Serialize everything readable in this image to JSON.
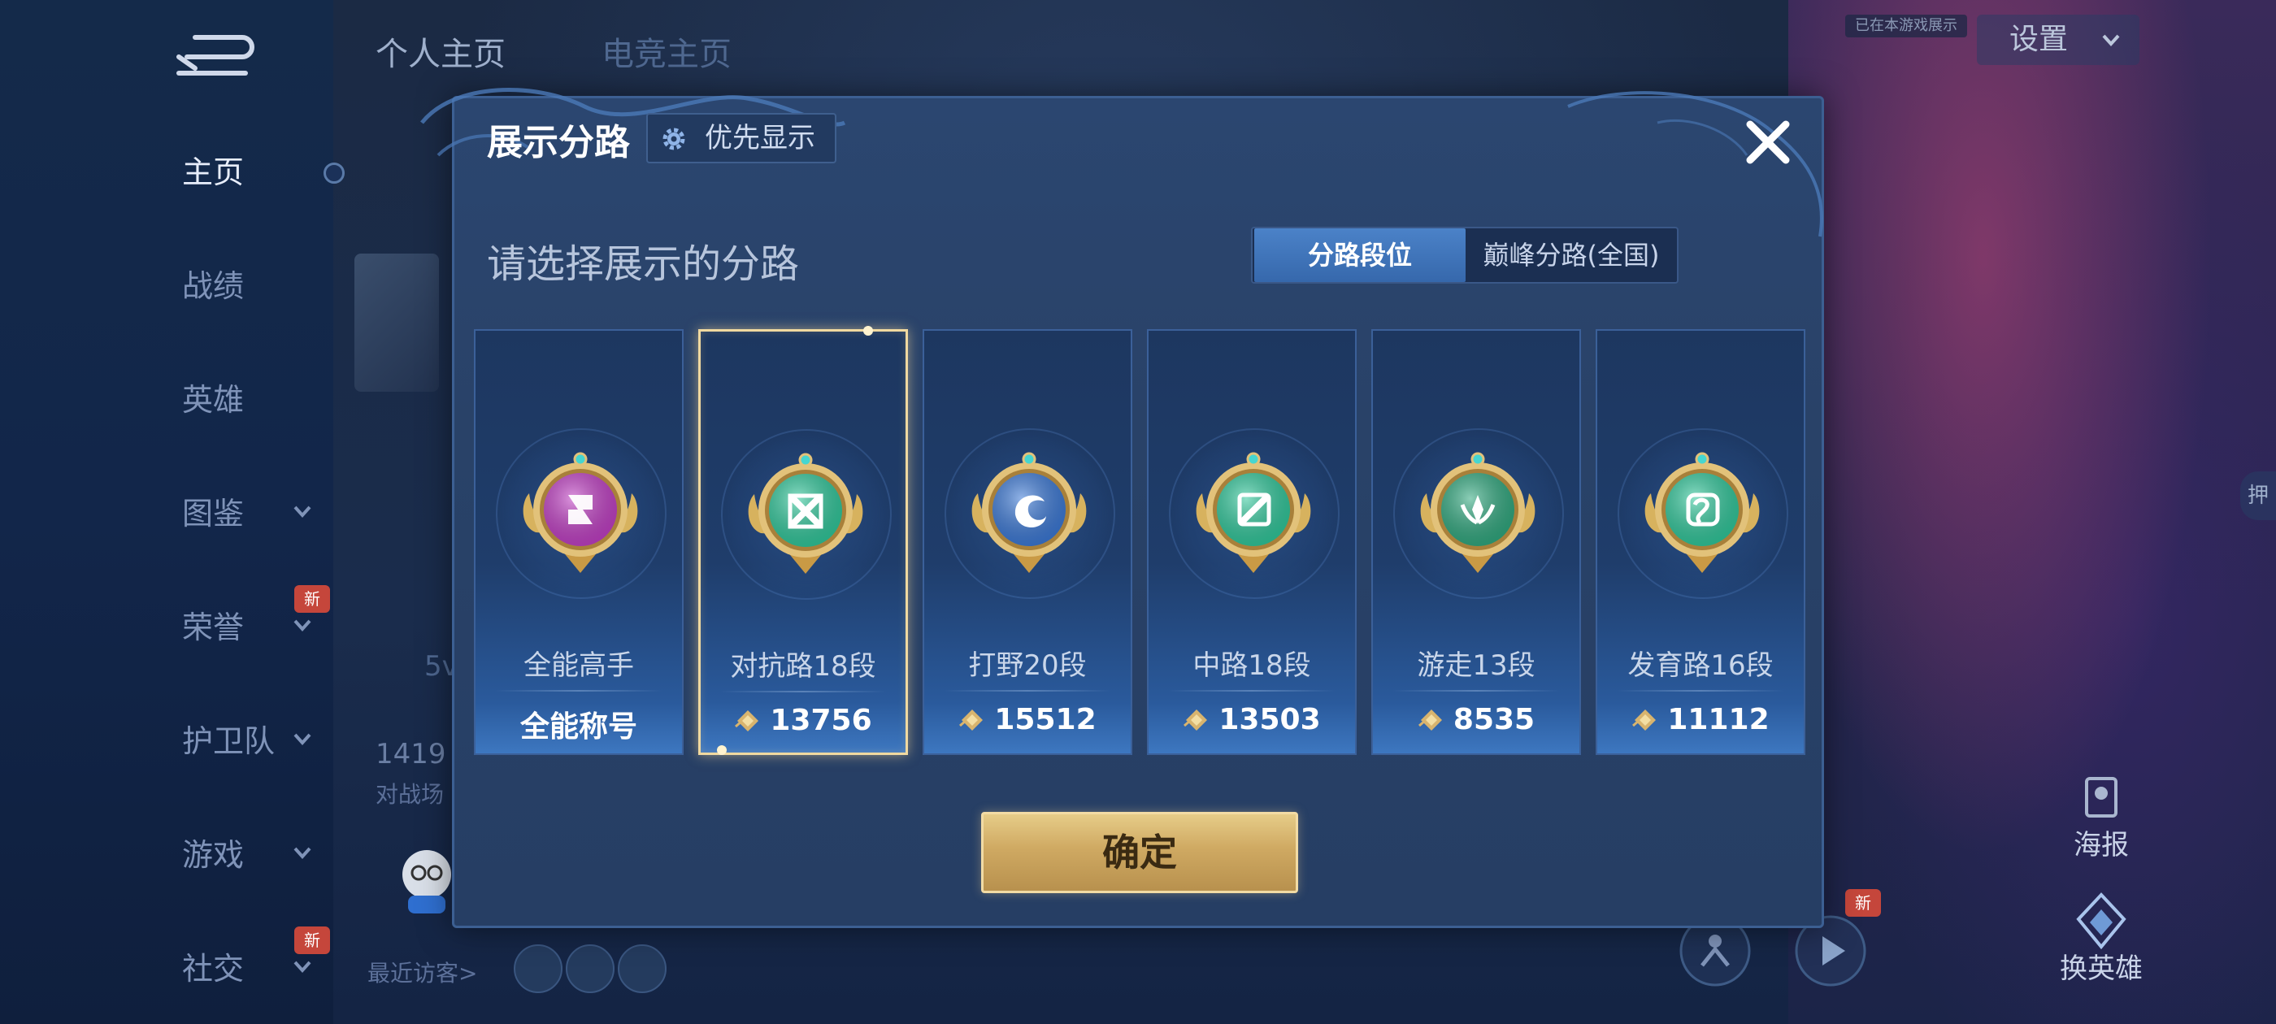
{
  "nav": {
    "items": [
      {
        "label": "主页",
        "active": true,
        "chevron": false,
        "new": false
      },
      {
        "label": "战绩",
        "active": false,
        "chevron": false,
        "new": false
      },
      {
        "label": "英雄",
        "active": false,
        "chevron": false,
        "new": false
      },
      {
        "label": "图鉴",
        "active": false,
        "chevron": true,
        "new": false
      },
      {
        "label": "荣誉",
        "active": false,
        "chevron": true,
        "new": true
      },
      {
        "label": "护卫队",
        "active": false,
        "chevron": true,
        "new": false
      },
      {
        "label": "游戏",
        "active": false,
        "chevron": true,
        "new": false
      },
      {
        "label": "社交",
        "active": false,
        "chevron": true,
        "new": true
      }
    ],
    "new_badge": "新"
  },
  "header": {
    "tabs": [
      "个人主页",
      "电竞主页"
    ],
    "settings_label": "设置",
    "chip_text": "已在本游戏展示"
  },
  "background": {
    "stat_number": "1419",
    "stat_label": "对战场",
    "side_text": "5v",
    "recent_visitors": "最近访客>",
    "poster_label": "海报",
    "change_hero_label": "换英雄",
    "new_badge": "新",
    "edge_badge": "押"
  },
  "dialog": {
    "title": "展示分路",
    "priority_label": "优先显示",
    "subheading": "请选择展示的分路",
    "segment": {
      "option1": "分路段位",
      "option2": "巅峰分路(全国)",
      "selected": "分路段位"
    },
    "cards": [
      {
        "name": "全能高手",
        "score": "全能称号",
        "has_icon": false,
        "badge": "versatile-badge-icon",
        "badge_color": "#c03ec4"
      },
      {
        "name": "对抗路18段",
        "score": "13756",
        "has_icon": true,
        "badge": "clash-lane-badge-icon",
        "badge_color": "#2fc79a",
        "selected": true
      },
      {
        "name": "打野20段",
        "score": "15512",
        "has_icon": true,
        "badge": "jungle-badge-icon",
        "badge_color": "#3a78d6"
      },
      {
        "name": "中路18段",
        "score": "13503",
        "has_icon": true,
        "badge": "mid-lane-badge-icon",
        "badge_color": "#2fc79a"
      },
      {
        "name": "游走13段",
        "score": "8535",
        "has_icon": true,
        "badge": "roam-badge-icon",
        "badge_color": "#2fa87e"
      },
      {
        "name": "发育路16段",
        "score": "11112",
        "has_icon": true,
        "badge": "farm-lane-badge-icon",
        "badge_color": "#2fc79a"
      }
    ],
    "confirm_label": "确定"
  },
  "colors": {
    "accent_gold": "#d8b46e",
    "dialog_bg": "#294268",
    "selected_border": "#f0d9a0"
  }
}
